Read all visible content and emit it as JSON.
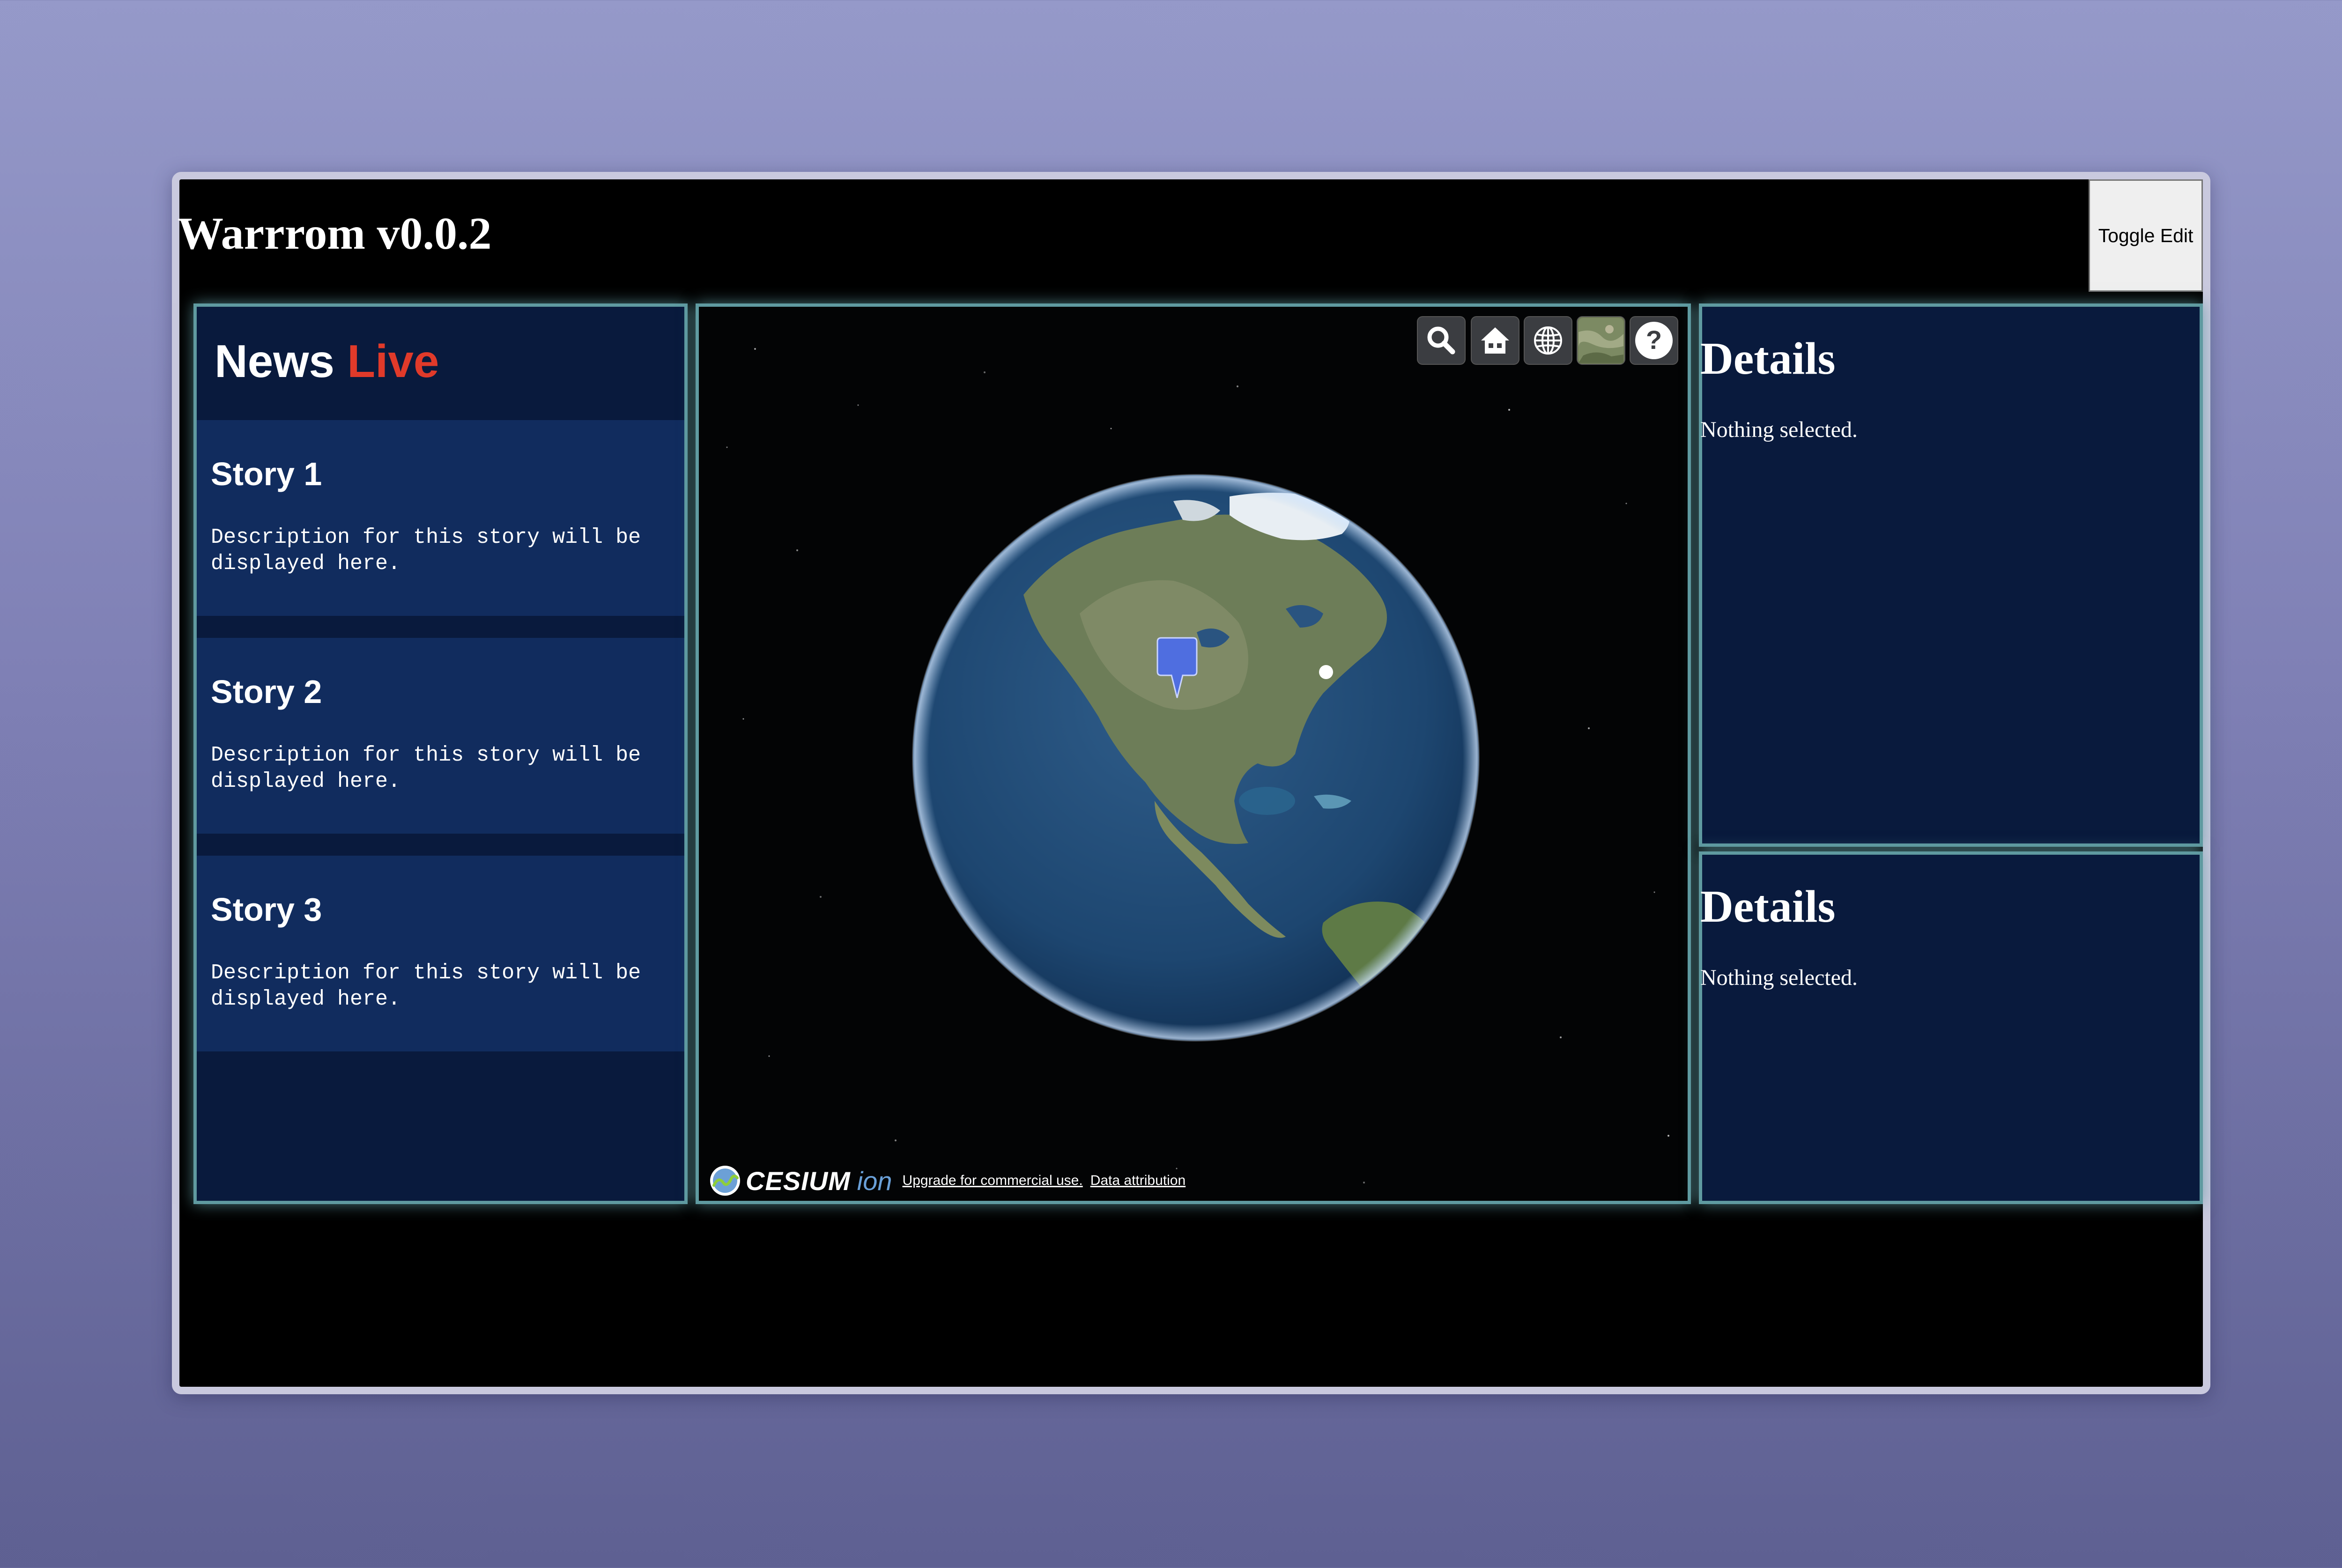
{
  "app": {
    "title": "Warrrom v0.0.2",
    "toggle_label": "Toggle Edit"
  },
  "news": {
    "heading_main": "News",
    "heading_live": "Live",
    "live_color": "#e03a2a",
    "stories": [
      {
        "title": "Story 1",
        "description": "Description for this story will be displayed here."
      },
      {
        "title": "Story 2",
        "description": "Description for this story will be displayed here."
      },
      {
        "title": "Story 3",
        "description": "Description for this story will be displayed here."
      }
    ]
  },
  "map": {
    "toolbar": [
      "search-icon",
      "home-icon",
      "globe-icon",
      "imagery-layer-icon",
      "help-icon"
    ],
    "help_glyph": "?",
    "marker_color": "#4f6ee0",
    "credits": {
      "brand": "CESIUM",
      "suffix": "ion",
      "upgrade_link": "Upgrade for commercial use.",
      "attribution_link": "Data attribution"
    }
  },
  "details": [
    {
      "heading": "Details",
      "text": "Nothing selected."
    },
    {
      "heading": "Details",
      "text": "Nothing selected."
    }
  ],
  "colors": {
    "panel_bg": "#091a3d",
    "story_bg": "#112c5e",
    "panel_border": "#5f9aa0"
  }
}
